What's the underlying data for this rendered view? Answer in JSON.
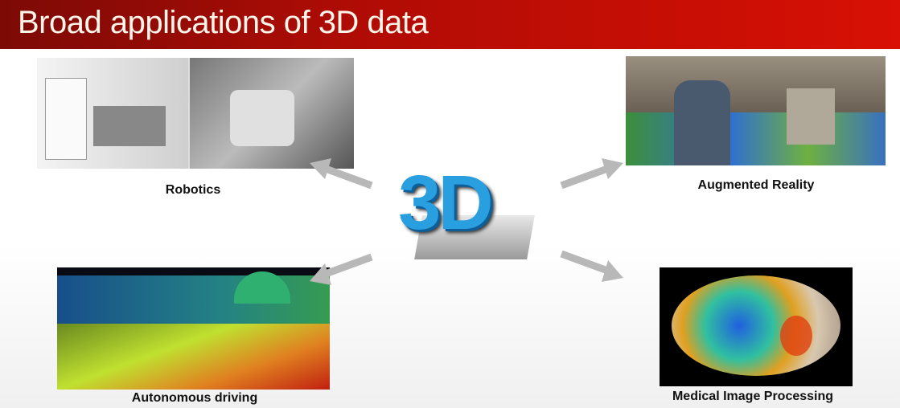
{
  "slide": {
    "title": "Broad applications of 3D data",
    "center_logo": "3D",
    "applications": [
      {
        "label": "Robotics"
      },
      {
        "label": "Augmented  Reality"
      },
      {
        "label": "Autonomous driving"
      },
      {
        "label": "Medical Image Processing"
      }
    ]
  },
  "colors": {
    "header": "#b00c05",
    "arrow": "#b8b8b8",
    "logo": "#2a9fe0"
  }
}
